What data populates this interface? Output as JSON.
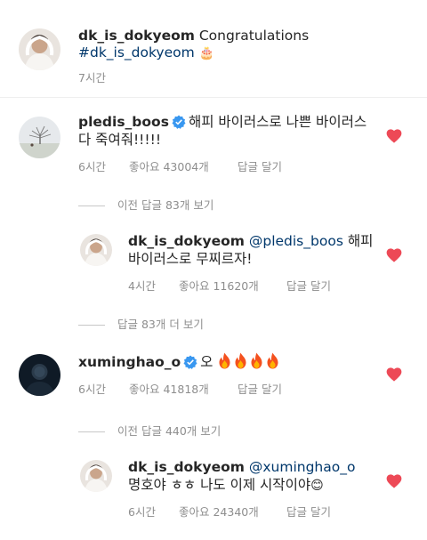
{
  "caption": {
    "username": "dk_is_dokyeom",
    "text": "Congratulations",
    "hashtag": "#dk_is_dokyeom",
    "emoji": "🎂",
    "time": "7시간"
  },
  "comments": [
    {
      "username": "pledis_boos",
      "verified": true,
      "text_line1": "해피 바이러스로 나쁜 바이러스",
      "text_line2": "다 죽여줘!!!!!",
      "time": "6시간",
      "likes": "좋아요 43004개",
      "reply": "답글 달기",
      "toggle": "이전 답글 83개 보기",
      "reply_item": {
        "username": "dk_is_dokyeom",
        "mention": "@pledis_boos",
        "text_line1_tail": "해피",
        "text_line2": "바이러스로 무찌르자!",
        "time": "4시간",
        "likes": "좋아요 11620개",
        "reply": "답글 달기"
      },
      "toggle_after": "답글 83개 더 보기"
    },
    {
      "username": "xuminghao_o",
      "verified": true,
      "text": "오",
      "fire_count": 4,
      "time": "6시간",
      "likes": "좋아요 41818개",
      "reply": "답글 달기",
      "toggle": "이전 답글 440개 보기",
      "reply_item": {
        "username": "dk_is_dokyeom",
        "mention": "@xuminghao_o",
        "text_line2": "명호야 ㅎㅎ 나도 이제 시작이야",
        "emoji": "😊",
        "time": "6시간",
        "likes": "좋아요 24340개",
        "reply": "답글 달기"
      }
    }
  ],
  "colors": {
    "heart": "#ed4956",
    "verified": "#3897f0",
    "mention": "#00376b",
    "meta": "#8e8e8e"
  },
  "icons": [
    "heart-icon",
    "verified-badge-icon",
    "fire-emoji-icon"
  ]
}
